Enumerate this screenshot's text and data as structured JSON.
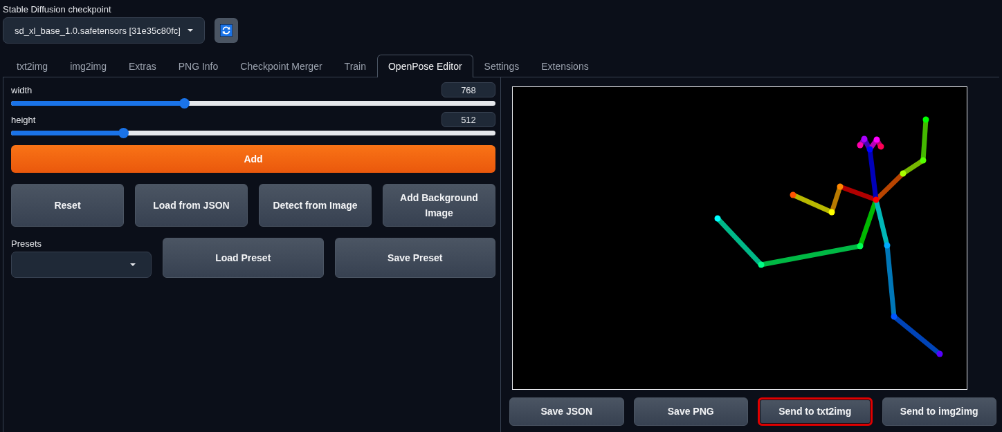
{
  "checkpoint": {
    "label": "Stable Diffusion checkpoint",
    "value": "sd_xl_base_1.0.safetensors [31e35c80fc]"
  },
  "tabs": [
    {
      "label": "txt2img",
      "selected": false
    },
    {
      "label": "img2img",
      "selected": false
    },
    {
      "label": "Extras",
      "selected": false
    },
    {
      "label": "PNG Info",
      "selected": false
    },
    {
      "label": "Checkpoint Merger",
      "selected": false
    },
    {
      "label": "Train",
      "selected": false
    },
    {
      "label": "OpenPose Editor",
      "selected": true
    },
    {
      "label": "Settings",
      "selected": false
    },
    {
      "label": "Extensions",
      "selected": false
    }
  ],
  "sliders": [
    {
      "label": "width",
      "value": "768",
      "level": 0.357
    },
    {
      "label": "height",
      "value": "512",
      "level": 0.232
    }
  ],
  "add_button": "Add",
  "action_buttons": [
    "Reset",
    "Load from JSON",
    "Detect from Image",
    "Add Background Image"
  ],
  "presets": {
    "label": "Presets"
  },
  "preset_buttons": [
    "Load Preset",
    "Save Preset"
  ],
  "output_buttons": [
    {
      "label": "Save JSON",
      "highlighted": false
    },
    {
      "label": "Save PNG",
      "highlighted": false
    },
    {
      "label": "Send to txt2img",
      "highlighted": true
    },
    {
      "label": "Send to img2img",
      "highlighted": false
    }
  ]
}
